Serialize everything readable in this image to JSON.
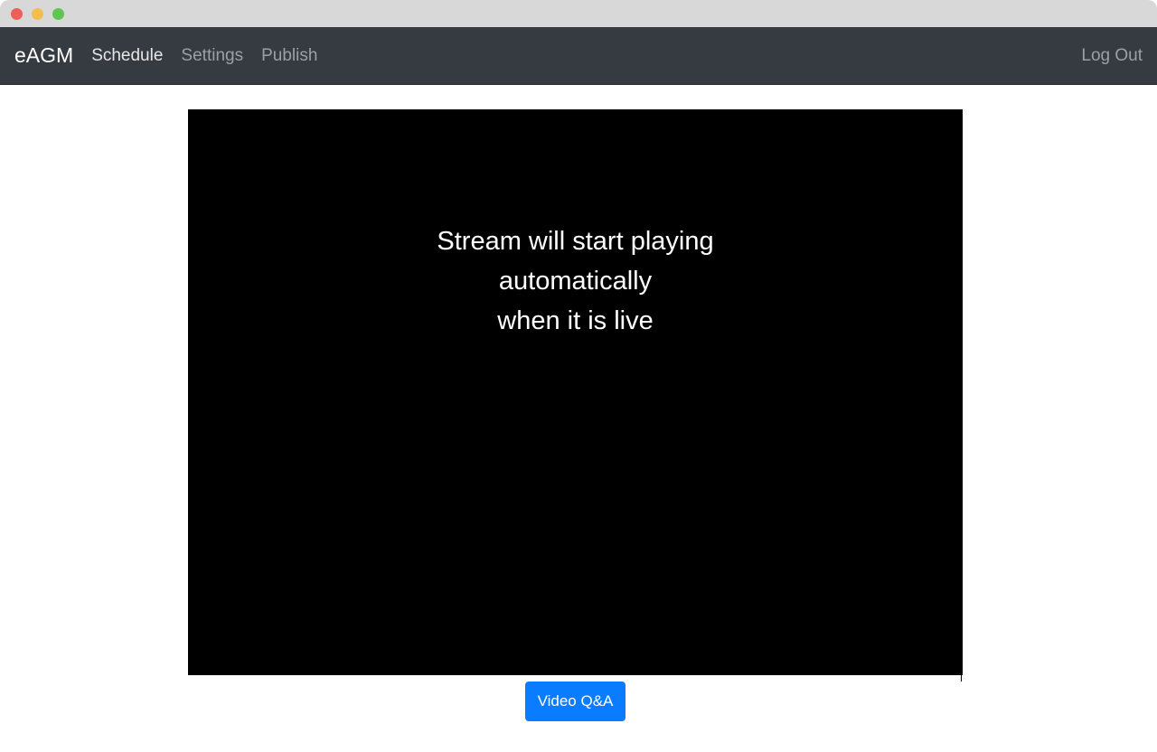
{
  "window": {
    "controls": [
      "close-icon",
      "minimize-icon",
      "maximize-icon"
    ]
  },
  "navbar": {
    "brand": "eAGM",
    "links": [
      {
        "label": "Schedule",
        "active": true
      },
      {
        "label": "Settings",
        "active": false
      },
      {
        "label": "Publish",
        "active": false
      }
    ],
    "logout_label": "Log Out"
  },
  "video": {
    "message_lines": [
      "Stream will start playing",
      "automatically",
      "when it is live"
    ]
  },
  "actions": {
    "qa_button_label": "Video Q&A"
  },
  "colors": {
    "navbar_bg": "#363b42",
    "accent": "#0a7cff",
    "video_bg": "#000000"
  }
}
